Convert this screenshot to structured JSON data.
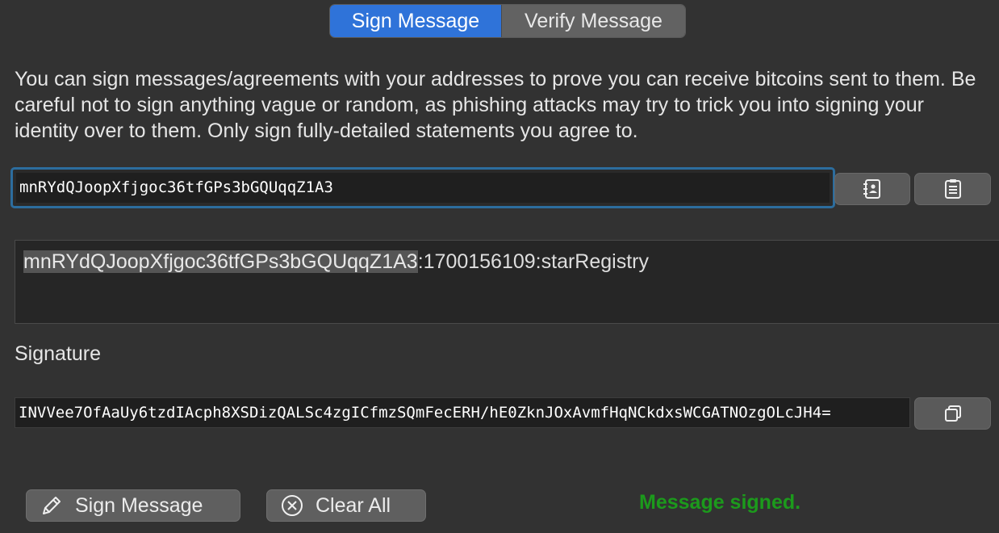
{
  "tabs": {
    "sign": "Sign Message",
    "verify": "Verify Message"
  },
  "description": "You can sign messages/agreements with your addresses to prove you can receive bitcoins sent to them. Be careful not to sign anything vague or random, as phishing attacks may try to trick you into signing your identity over to them. Only sign fully-detailed statements you agree to.",
  "address": {
    "value": "mnRYdQJoopXfjgoc36tfGPs3bGQUqqZ1A3"
  },
  "message": {
    "highlighted": "mnRYdQJoopXfjgoc36tfGPs3bGQUqqZ1A3",
    "rest": ":1700156109:starRegistry"
  },
  "signature": {
    "label": "Signature",
    "value": "INVVee7OfAaUy6tzdIAcph8XSDizQALSc4zgICfmzSQmFecERH/hE0ZknJOxAvmfHqNCkdxsWCGATNOzgOLcJH4="
  },
  "actions": {
    "sign": "Sign Message",
    "clear": "Clear All"
  },
  "status": {
    "text": "Message signed.",
    "color": "#1c9a1c"
  },
  "icons": {
    "address_book": "address-book-icon",
    "paste": "clipboard-paste-icon",
    "copy": "copy-icon",
    "sign": "pencil-icon",
    "clear": "circle-x-icon"
  }
}
